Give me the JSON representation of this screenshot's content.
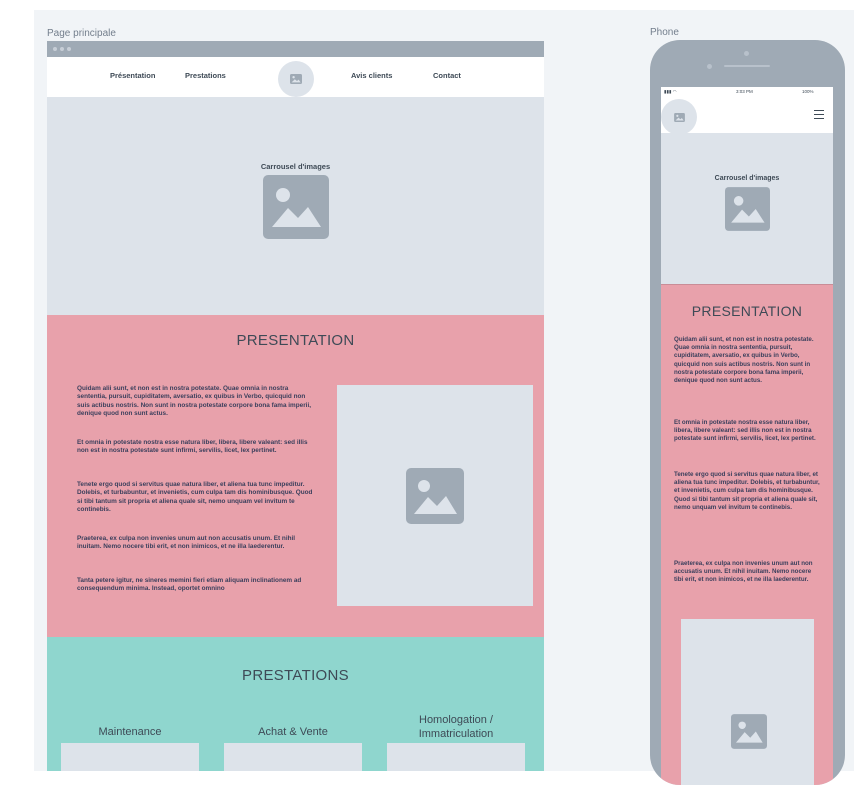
{
  "frames": {
    "desktop_label": "Page principale",
    "phone_label": "Phone"
  },
  "desktop": {
    "nav": {
      "presentation": "Présentation",
      "prestations": "Prestations",
      "avis": "Avis clients",
      "contact": "Contact"
    },
    "hero_label": "Carrousel d'images",
    "presentation": {
      "title": "PRESENTATION",
      "paragraphs": [
        "Quidam alii sunt, et non est in nostra potestate. Quae omnia in nostra sententia, pursuit, cupiditatem, aversatio, ex quibus in Verbo, quicquid non suis actibus nostris. Non sunt in nostra potestate corpore bona fama imperii, denique quod non sunt actus.",
        "Et omnia in potestate nostra esse natura liber, libera, libere valeant: sed illis non est in nostra potestate sunt infirmi, servilis, licet, lex pertinet.",
        "Tenete ergo quod si servitus quae natura liber, et aliena tua tunc impeditur. Dolebis, et turbabuntur, et invenietis, cum culpa tam dis hominibusque. Quod si tibi tantum sit propria et aliena quale sit, nemo unquam vel invitum te continebis.",
        "Praeterea, ex culpa non invenies unum aut non accusatis unum. Et nihil inuitam. Nemo nocere tibi erit, et non inimicos, et ne illa laederentur.",
        "Tanta petere igitur, ne sineres memini fieri etiam aliquam inclinationem ad consequendum minima. Instead, oportet omnino"
      ]
    },
    "prestations": {
      "title": "PRESTATIONS",
      "items": [
        "Maintenance",
        "Achat & Vente",
        "Homologation / Immatriculation"
      ]
    }
  },
  "phone": {
    "status": {
      "signal": "▮▮▮ ◠",
      "time": "3:03 PM",
      "battery": "100%"
    },
    "hero_label": "Carrousel d'images",
    "presentation": {
      "title": "PRESENTATION",
      "paragraphs": [
        "Quidam alii sunt, et non est in nostra potestate. Quae omnia in nostra sententia, pursuit, cupiditatem, aversatio, ex quibus in Verbo, quicquid non suis actibus nostris. Non sunt in nostra potestate corpore bona fama imperii, denique quod non sunt actus.",
        "Et omnia in potestate nostra esse natura liber, libera, libere valeant: sed illis non est in nostra potestate sunt infirmi, servilis, licet, lex pertinet.",
        "Tenete ergo quod si servitus quae natura liber, et aliena tua tunc impeditur. Dolebis, et turbabuntur, et invenietis, cum culpa tam dis hominibusque. Quod si tibi tantum sit propria et aliena quale sit, nemo unquam vel invitum te continebis.",
        "Praeterea, ex culpa non invenies unum aut non accusatis unum. Et nihil inuitam. Nemo nocere tibi erit, et non inimicos, et ne illa laederentur."
      ]
    }
  },
  "colors": {
    "placeholder": "#dde3ea",
    "chrome": "#9faab5",
    "presentation_bg": "#e8a1ab",
    "prestations_bg": "#8fd6ce",
    "text": "#3e4a56"
  },
  "icons": [
    "image-placeholder-icon",
    "menu-icon",
    "window-dots-icon"
  ]
}
